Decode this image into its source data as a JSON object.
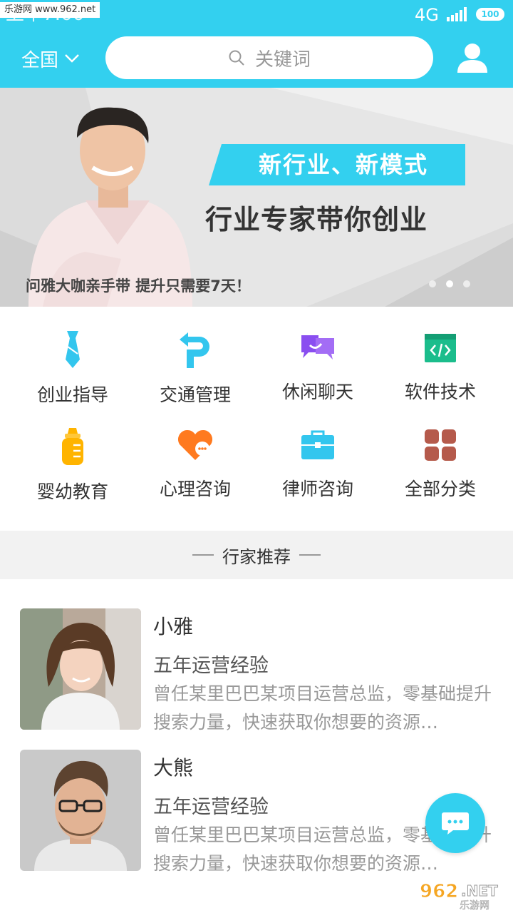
{
  "status_bar": {
    "watermark": "乐游网 www.962.net",
    "time": "上午7:00",
    "network": "4G",
    "battery": "100"
  },
  "header": {
    "region": "全国",
    "search_placeholder": "关键词"
  },
  "banner": {
    "tag": "新行业、新模式",
    "title": "行业专家带你创业",
    "caption": "问雅大咖亲手带 提升只需要7天！",
    "active_dot": 2
  },
  "categories": [
    {
      "label": "创业指导",
      "icon": "tie-icon",
      "color": "#33c6ee"
    },
    {
      "label": "交通管理",
      "icon": "parking-icon",
      "color": "#33c6ee"
    },
    {
      "label": "休闲聊天",
      "icon": "chat-bubbles-icon",
      "color": "#8a4ef0"
    },
    {
      "label": "软件技术",
      "icon": "code-icon",
      "color": "#1bbd8c"
    },
    {
      "label": "婴幼教育",
      "icon": "baby-bottle-icon",
      "color": "#ffb400"
    },
    {
      "label": "心理咨询",
      "icon": "heart-chat-icon",
      "color": "#ff7a1f"
    },
    {
      "label": "律师咨询",
      "icon": "briefcase-icon",
      "color": "#33c6ee"
    },
    {
      "label": "全部分类",
      "icon": "grid-icon",
      "color": "#b55a4b"
    }
  ],
  "section_title": "行家推荐",
  "experts": [
    {
      "name": "小雅",
      "experience": "五年运营经验",
      "description": "曾任某里巴巴某项目运营总监，零基础提升搜索力量，快速获取你想要的资源…"
    },
    {
      "name": "大熊",
      "experience": "五年运营经验",
      "description": "曾任某里巴巴某项目运营总监，零基础提升搜索力量，快速获取你想要的资源…"
    }
  ],
  "corner_logo": "962.NET 乐游网"
}
